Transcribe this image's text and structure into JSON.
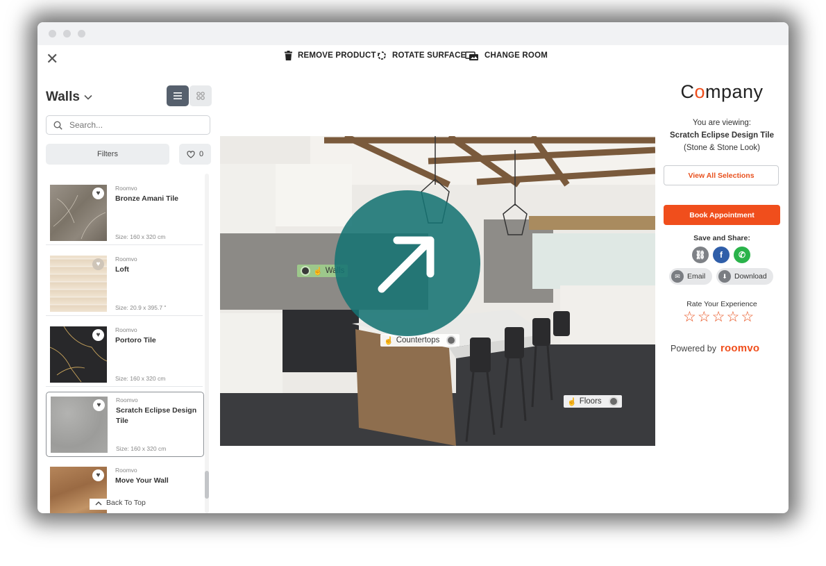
{
  "toolbar": {
    "remove_product": "REMOVE PRODUCT",
    "rotate_surface": "ROTATE SURFACE",
    "change_room": "CHANGE ROOM"
  },
  "sidebar": {
    "title": "Walls",
    "search_placeholder": "Search...",
    "filters_label": "Filters",
    "favorites_count": "0",
    "back_to_top": "Back To Top",
    "products": [
      {
        "brand": "Roomvo",
        "name": "Bronze Amani Tile",
        "size": "Size: 160 x 320 cm",
        "color": "#8a8378"
      },
      {
        "brand": "Roomvo",
        "name": "Loft",
        "size": "Size: 20.9 x 395.7 \"",
        "color": "#e7d7c2"
      },
      {
        "brand": "Roomvo",
        "name": "Portoro Tile",
        "size": "Size: 160 x 320 cm",
        "color": "#2a2a2c"
      },
      {
        "brand": "Roomvo",
        "name": "Scratch Eclipse Design Tile",
        "size": "Size: 160 x 320 cm",
        "color": "#a3a3a1"
      },
      {
        "brand": "Roomvo",
        "name": "Move Your Wall",
        "size": "",
        "color": "#a9774d"
      }
    ]
  },
  "scene": {
    "hotspots": {
      "walls": "Walls",
      "countertops": "Countertops",
      "floors": "Floors"
    }
  },
  "details": {
    "company": "Company",
    "viewing_label": "You are viewing:",
    "product_name": "Scratch Eclipse Design Tile",
    "product_category": "(Stone & Stone Look)",
    "view_all": "View All Selections",
    "book": "Book Appointment",
    "share_label": "Save and Share:",
    "email": "Email",
    "download": "Download",
    "rate_label": "Rate Your Experience",
    "powered_by": "Powered by",
    "powered_brand": "roomvo"
  },
  "colors": {
    "accent": "#f04e1c",
    "overlay": "#167373",
    "facebook": "#2f5ea9",
    "whatsapp": "#2ab34a"
  }
}
